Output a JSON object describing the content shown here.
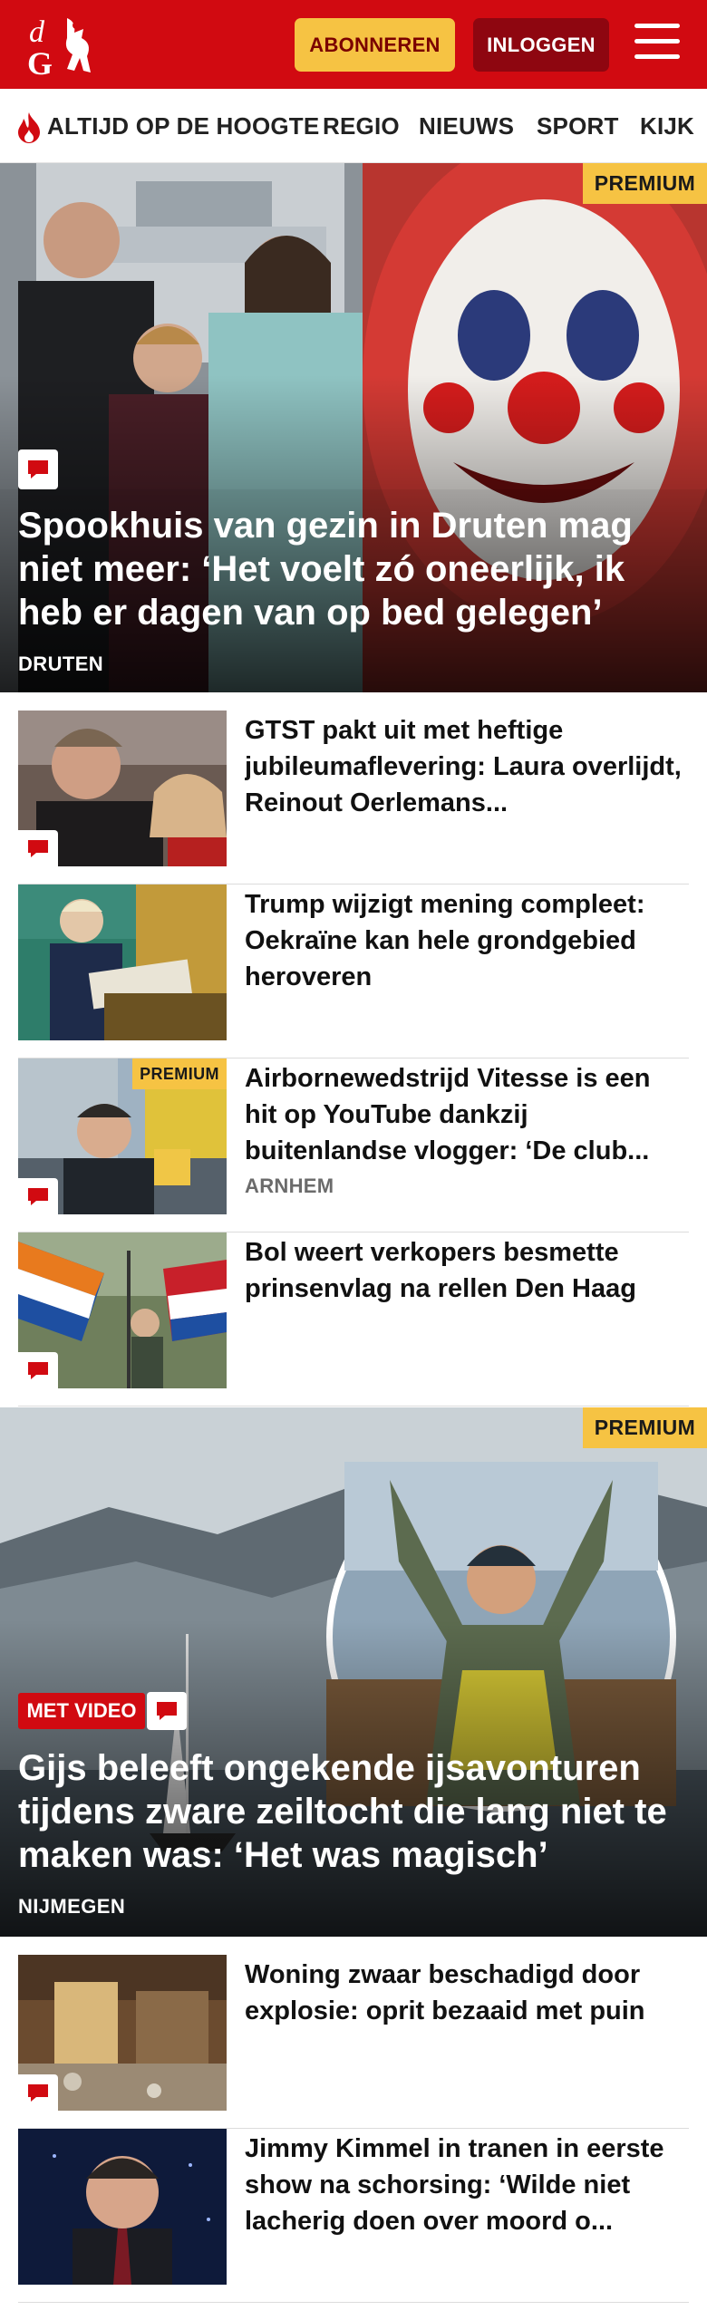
{
  "header": {
    "logo_text": "dG",
    "subscribe_label": "ABONNEREN",
    "login_label": "INLOGGEN",
    "menu_icon": "hamburger-icon"
  },
  "nav": {
    "items": [
      "ALTIJD OP DE HOOGTE",
      "REGIO",
      "NIEUWS",
      "SPORT",
      "KIJK"
    ],
    "first_item_icon": "flame-icon"
  },
  "hero1": {
    "badge": "PREMIUM",
    "title": "Spookhuis van gezin in Druten mag niet meer: ‘Het voelt zó oneerlijk, ik heb er dagen van op bed gelegen’",
    "region": "DRUTEN",
    "comment_icon": "comment-icon"
  },
  "articles_1": [
    {
      "title": "GTST pakt uit met heftige jubileumaflevering: Laura overlijdt, Reinout Oerlemans...",
      "region": "",
      "premium": ""
    },
    {
      "title": "Trump wijzigt mening compleet: Oekraïne kan hele grondgebied heroveren",
      "region": "",
      "premium": ""
    },
    {
      "title": "Airbornewedstrijd Vitesse is een hit op YouTube dankzij buitenlandse vlogger: ‘De club...",
      "region": "ARNHEM",
      "premium": "PREMIUM"
    },
    {
      "title": "Bol weert verkopers besmette prinsenvlag na rellen Den Haag",
      "region": "",
      "premium": ""
    }
  ],
  "hero2": {
    "badge": "PREMIUM",
    "video_label": "MET VIDEO",
    "title": "Gijs beleeft ongekende ijsavonturen tijdens zware zeiltocht die lang niet te maken was: ‘Het was magisch’",
    "region": "NIJMEGEN"
  },
  "articles_2": [
    {
      "title": "Woning zwaar beschadigd door explosie: oprit bezaaid met puin"
    },
    {
      "title": "Jimmy Kimmel in tranen in eerste show na schorsing: ‘Wilde niet lacherig doen over moord o..."
    }
  ],
  "colors": {
    "brand_red": "#d10a11",
    "premium_yellow": "#f6c343",
    "login_dark_red": "#8e0610"
  }
}
